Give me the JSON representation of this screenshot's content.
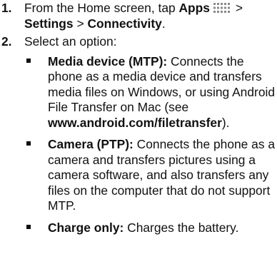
{
  "steps": [
    {
      "number": "1.",
      "prefix": "From the Home screen, tap ",
      "apps_label": "Apps",
      "apps_icon": "apps-grid-icon",
      "sep1": " > ",
      "settings_label": "Settings",
      "sep2": " > ",
      "connectivity_label": "Connectivity",
      "suffix": "."
    },
    {
      "number": "2.",
      "text": "Select an option:"
    }
  ],
  "options": [
    {
      "title": "Media device (MTP):",
      "desc_before_url": " Connects the phone as a media device and transfers media files on Windows, or using Android File Transfer on Mac (see ",
      "url": "www.android.com/filetransfer",
      "desc_after_url": ")."
    },
    {
      "title": "Camera (PTP):",
      "desc": " Connects the phone as a camera and transfers pictures using a camera software, and also transfers any files on the computer that do not support MTP."
    },
    {
      "title": "Charge only:",
      "desc": " Charges the battery."
    }
  ]
}
